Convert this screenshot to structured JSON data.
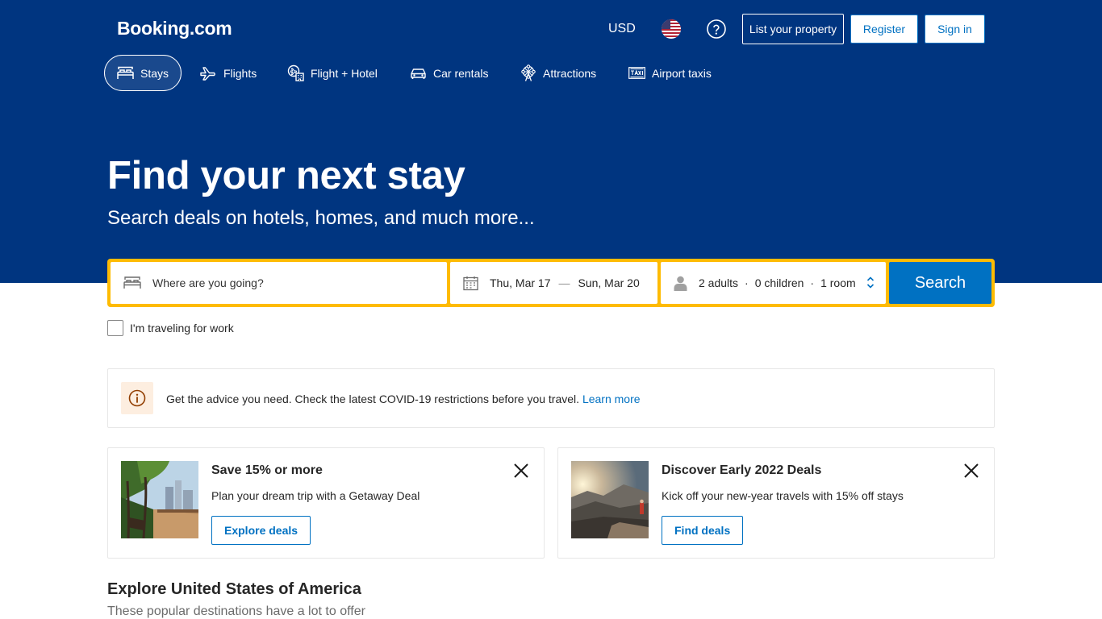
{
  "header": {
    "logo": "Booking.com",
    "currency": "USD",
    "list_property": "List your property",
    "register": "Register",
    "sign_in": "Sign in"
  },
  "nav": {
    "stays": "Stays",
    "flights": "Flights",
    "flight_hotel": "Flight + Hotel",
    "car_rentals": "Car rentals",
    "attractions": "Attractions",
    "airport_taxis": "Airport taxis"
  },
  "hero": {
    "title": "Find your next stay",
    "subtitle": "Search deals on hotels, homes, and much more..."
  },
  "search": {
    "destination_placeholder": "Where are you going?",
    "checkin": "Thu, Mar 17",
    "date_sep": "—",
    "checkout": "Sun, Mar 20",
    "adults": "2 adults",
    "children": "0 children",
    "rooms": "1 room",
    "dot": "·",
    "button": "Search",
    "work_label": "I'm traveling for work"
  },
  "covid": {
    "text": "Get the advice you need. Check the latest COVID-19 restrictions before you travel.",
    "link": "Learn more"
  },
  "cards": [
    {
      "title": "Save 15% or more",
      "desc": "Plan your dream trip with a Getaway Deal",
      "button": "Explore deals"
    },
    {
      "title": "Discover Early 2022 Deals",
      "desc": "Kick off your new-year travels with 15% off stays",
      "button": "Find deals"
    }
  ],
  "explore": {
    "title": "Explore United States of America",
    "subtitle": "These popular destinations have a lot to offer"
  },
  "colors": {
    "brand_blue": "#003580",
    "action_blue": "#0071c2",
    "search_yellow": "#febb02"
  }
}
